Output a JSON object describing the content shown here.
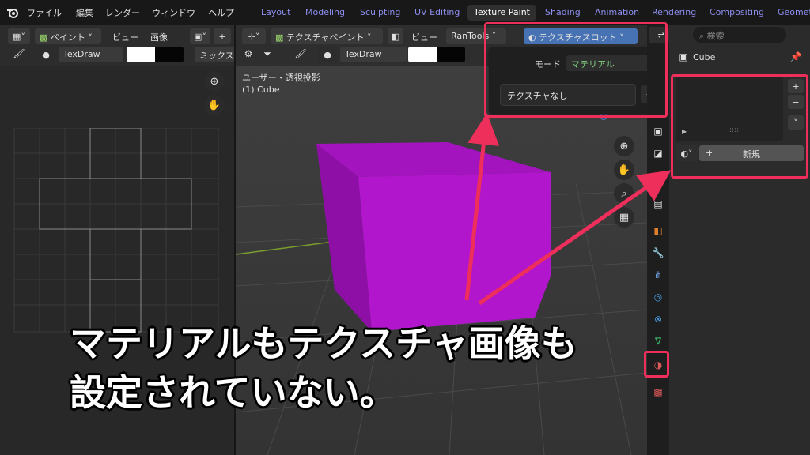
{
  "menu": {
    "items": [
      "ファイル",
      "編集",
      "レンダー",
      "ウィンドウ",
      "ヘルプ"
    ]
  },
  "workspace_tabs": [
    "Layout",
    "Modeling",
    "Sculpting",
    "UV Editing",
    "Texture Paint",
    "Shading",
    "Animation",
    "Rendering",
    "Compositing",
    "Geomet"
  ],
  "active_workspace": "Texture Paint",
  "image_editor": {
    "mode": "ペイント",
    "view": "ビュー",
    "image": "画像",
    "brush_name": "TexDraw",
    "blend": "ミックス"
  },
  "viewport": {
    "mode": "テクスチャペイント",
    "view": "ビュー",
    "addon": "RanTools",
    "texture_slots": "テクスチャスロット",
    "brush_name": "TexDraw",
    "overlay_title": "ユーザー・透視投影",
    "overlay_object": "(1) Cube",
    "cube_color": "#a010b8"
  },
  "slot_popup": {
    "mode_label": "モード",
    "mode_value": "マテリアル",
    "texture_value": "テクスチャなし"
  },
  "properties": {
    "search_placeholder": "検索",
    "object_name": "Cube",
    "new_button": "新規"
  },
  "caption": {
    "line1": "マテリアルもテクスチャ画像も",
    "line2": "設定されていない。"
  },
  "colors": {
    "highlight": "#ee2f5b",
    "accent": "#4772b3"
  }
}
